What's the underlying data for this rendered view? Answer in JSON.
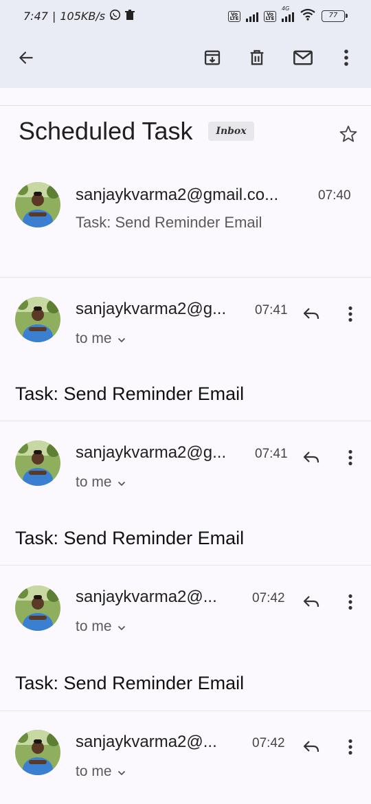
{
  "status_bar": {
    "time": "7:47",
    "separator": "|",
    "speed": "105KB/s",
    "battery": "77",
    "network": "4G"
  },
  "toolbar": {
    "back_icon": "arrow-left-icon",
    "archive_icon": "archive-icon",
    "delete_icon": "trash-icon",
    "mark_unread_icon": "envelope-icon",
    "more_icon": "more-vert-icon"
  },
  "subject": {
    "title": "Scheduled Task",
    "label": "Inbox"
  },
  "summary": {
    "sender": "sanjaykvarma2@gmail.co...",
    "time": "07:40",
    "snippet": "Task: Send Reminder Email"
  },
  "messages": [
    {
      "sender": "sanjaykvarma2@g...",
      "time": "07:41",
      "recipient": "to me",
      "body": "Task: Send Reminder Email"
    },
    {
      "sender": "sanjaykvarma2@g...",
      "time": "07:41",
      "recipient": "to me",
      "body": "Task: Send Reminder Email"
    },
    {
      "sender": "sanjaykvarma2@...",
      "time": "07:42",
      "recipient": "to me",
      "body": "Task: Send Reminder Email"
    },
    {
      "sender": "sanjaykvarma2@...",
      "time": "07:42",
      "recipient": "to me",
      "body": ""
    }
  ],
  "colors": {
    "toolbar_bg": "#e9ecf4",
    "page_bg": "#fbf9fe",
    "avatar_shirt": "#3a7fd0"
  }
}
